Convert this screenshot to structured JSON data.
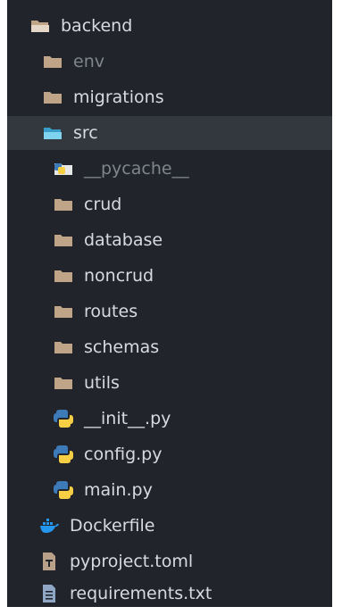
{
  "explorer": {
    "root": {
      "label": "backend",
      "icon": "folder-open-icon"
    },
    "backend_children": [
      {
        "label": "env",
        "icon": "folder-icon"
      },
      {
        "label": "migrations",
        "icon": "folder-icon"
      }
    ],
    "src": {
      "label": "src",
      "icon": "folder-open-icon"
    },
    "src_children": [
      {
        "label": "__pycache__",
        "icon": "folder-python-icon"
      },
      {
        "label": "crud",
        "icon": "folder-icon"
      },
      {
        "label": "database",
        "icon": "folder-icon"
      },
      {
        "label": "noncrud",
        "icon": "folder-icon"
      },
      {
        "label": "routes",
        "icon": "folder-icon"
      },
      {
        "label": "schemas",
        "icon": "folder-icon"
      },
      {
        "label": "utils",
        "icon": "folder-icon"
      },
      {
        "label": "__init__.py",
        "icon": "python-icon"
      },
      {
        "label": "config.py",
        "icon": "python-icon"
      },
      {
        "label": "main.py",
        "icon": "python-icon"
      }
    ],
    "root_files": [
      {
        "label": "Dockerfile",
        "icon": "docker-icon"
      },
      {
        "label": "pyproject.toml",
        "icon": "toml-file-icon"
      },
      {
        "label": "requirements.txt",
        "icon": "text-file-icon"
      }
    ]
  },
  "colors": {
    "background": "#21252b",
    "selected_row": "#33383f",
    "text": "#d7dae0",
    "dim_text": "#7f848e",
    "folder": "#c0a488",
    "open_folder": "#6ec6e6",
    "python_blue": "#3d7ab8",
    "python_yellow": "#f6cf44",
    "docker": "#2496ed"
  }
}
